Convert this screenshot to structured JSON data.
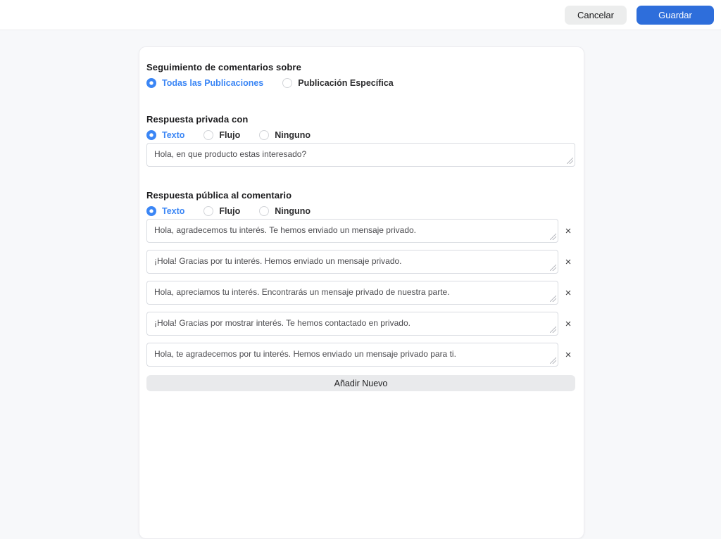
{
  "header": {
    "cancel_label": "Cancelar",
    "save_label": "Guardar"
  },
  "colors": {
    "accent_blue": "#3b86f5",
    "save_button_blue": "#2e6edb",
    "page_background": "#f7f8fa",
    "card_background": "#ffffff"
  },
  "form": {
    "section_tracking": {
      "title": "Seguimiento de comentarios sobre",
      "options": [
        {
          "label": "Todas las Publicaciones",
          "selected": true
        },
        {
          "label": "Publicación Específica",
          "selected": false
        }
      ]
    },
    "section_private": {
      "title": "Respuesta privada con",
      "options": [
        {
          "label": "Texto",
          "selected": true
        },
        {
          "label": "Flujo",
          "selected": false
        },
        {
          "label": "Ninguno",
          "selected": false
        }
      ],
      "message": "Hola, en que producto estas interesado?"
    },
    "section_public": {
      "title": "Respuesta pública al comentario",
      "options": [
        {
          "label": "Texto",
          "selected": true
        },
        {
          "label": "Flujo",
          "selected": false
        },
        {
          "label": "Ninguno",
          "selected": false
        }
      ],
      "messages": [
        "Hola, agradecemos tu interés. Te hemos enviado un mensaje privado.",
        "¡Hola! Gracias por tu interés. Hemos enviado un mensaje privado.",
        "Hola, apreciamos tu interés. Encontrarás un mensaje privado de nuestra parte.",
        "¡Hola! Gracias por mostrar interés. Te hemos contactado en privado.",
        "Hola, te agradecemos por tu interés. Hemos enviado un mensaje privado para ti."
      ],
      "remove_label": "×",
      "add_button_label": "Añadir Nuevo"
    }
  }
}
